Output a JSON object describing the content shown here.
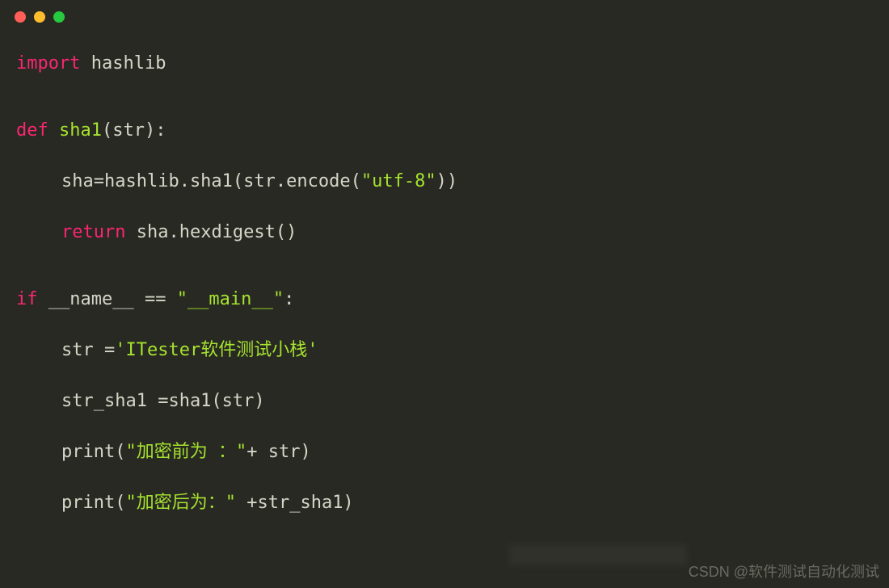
{
  "window_controls": {
    "close": "close",
    "minimize": "minimize",
    "maximize": "maximize"
  },
  "code": {
    "line1_kw": "import",
    "line1_mod": " hashlib",
    "line2_kw": "def",
    "line2_fn": " sha1",
    "line2_rest": "(str):",
    "line3": "sha=hashlib.sha1(str.encode(",
    "line3_str": "\"utf-8\"",
    "line3_end": "))",
    "line4_kw": "return",
    "line4_rest": " sha.hexdigest()",
    "line5_kw": "if",
    "line5_name": " __name__ == ",
    "line5_str": "\"__main__\"",
    "line5_end": ":",
    "line6_a": "str =",
    "line6_str": "'ITester软件测试小栈'",
    "line7": "str_sha1 =sha1(str)",
    "line8_a": "print(",
    "line8_str": "\"加密前为 ：\"",
    "line8_end": "+ str)",
    "line9_a": "print(",
    "line9_str": "\"加密后为：\"",
    "line9_end": " +str_sha1)"
  },
  "watermark": "CSDN @软件测试自动化测试"
}
